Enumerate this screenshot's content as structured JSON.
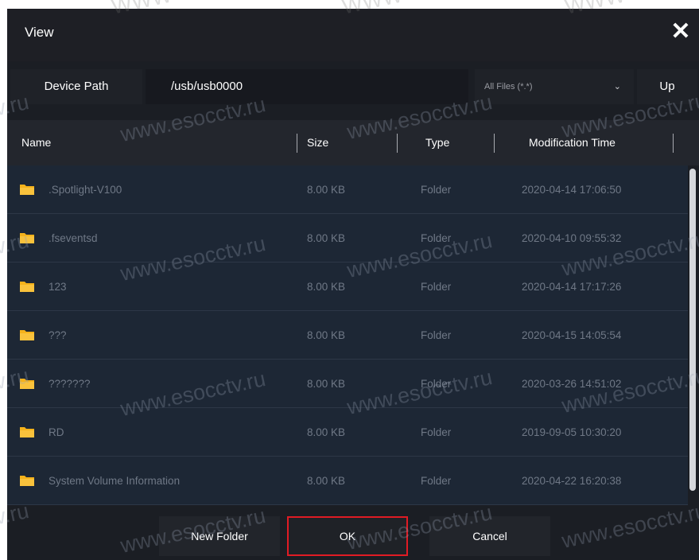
{
  "dialog": {
    "title": "View",
    "close_icon": "close-icon"
  },
  "path_bar": {
    "label": "Device Path",
    "value": "/usb/usb0000",
    "filter_selected": "All Files (*.*)",
    "up_label": "Up"
  },
  "table": {
    "headers": {
      "name": "Name",
      "size": "Size",
      "type": "Type",
      "time": "Modification Time"
    },
    "rows": [
      {
        "name": ".Spotlight-V100",
        "size": "8.00 KB",
        "type": "Folder",
        "time": "2020-04-14 17:06:50"
      },
      {
        "name": ".fseventsd",
        "size": "8.00 KB",
        "type": "Folder",
        "time": "2020-04-10 09:55:32"
      },
      {
        "name": "123",
        "size": "8.00 KB",
        "type": "Folder",
        "time": "2020-04-14 17:17:26"
      },
      {
        "name": "???",
        "size": "8.00 KB",
        "type": "Folder",
        "time": "2020-04-15 14:05:54"
      },
      {
        "name": "???????",
        "size": "8.00 KB",
        "type": "Folder",
        "time": "2020-03-26 14:51:02"
      },
      {
        "name": "RD",
        "size": "8.00 KB",
        "type": "Folder",
        "time": "2019-09-05 10:30:20"
      },
      {
        "name": "System Volume Information",
        "size": "8.00 KB",
        "type": "Folder",
        "time": "2020-04-22 16:20:38"
      }
    ]
  },
  "footer": {
    "new_folder": "New Folder",
    "ok": "OK",
    "cancel": "Cancel"
  },
  "watermark": {
    "text": "www.esocctv.ru",
    "fragment": "tv.ru",
    "top_fragment": "WWW"
  },
  "colors": {
    "folder": "#f5b21b",
    "ok_highlight": "#e01b24",
    "row_bg": "#1d2735"
  }
}
